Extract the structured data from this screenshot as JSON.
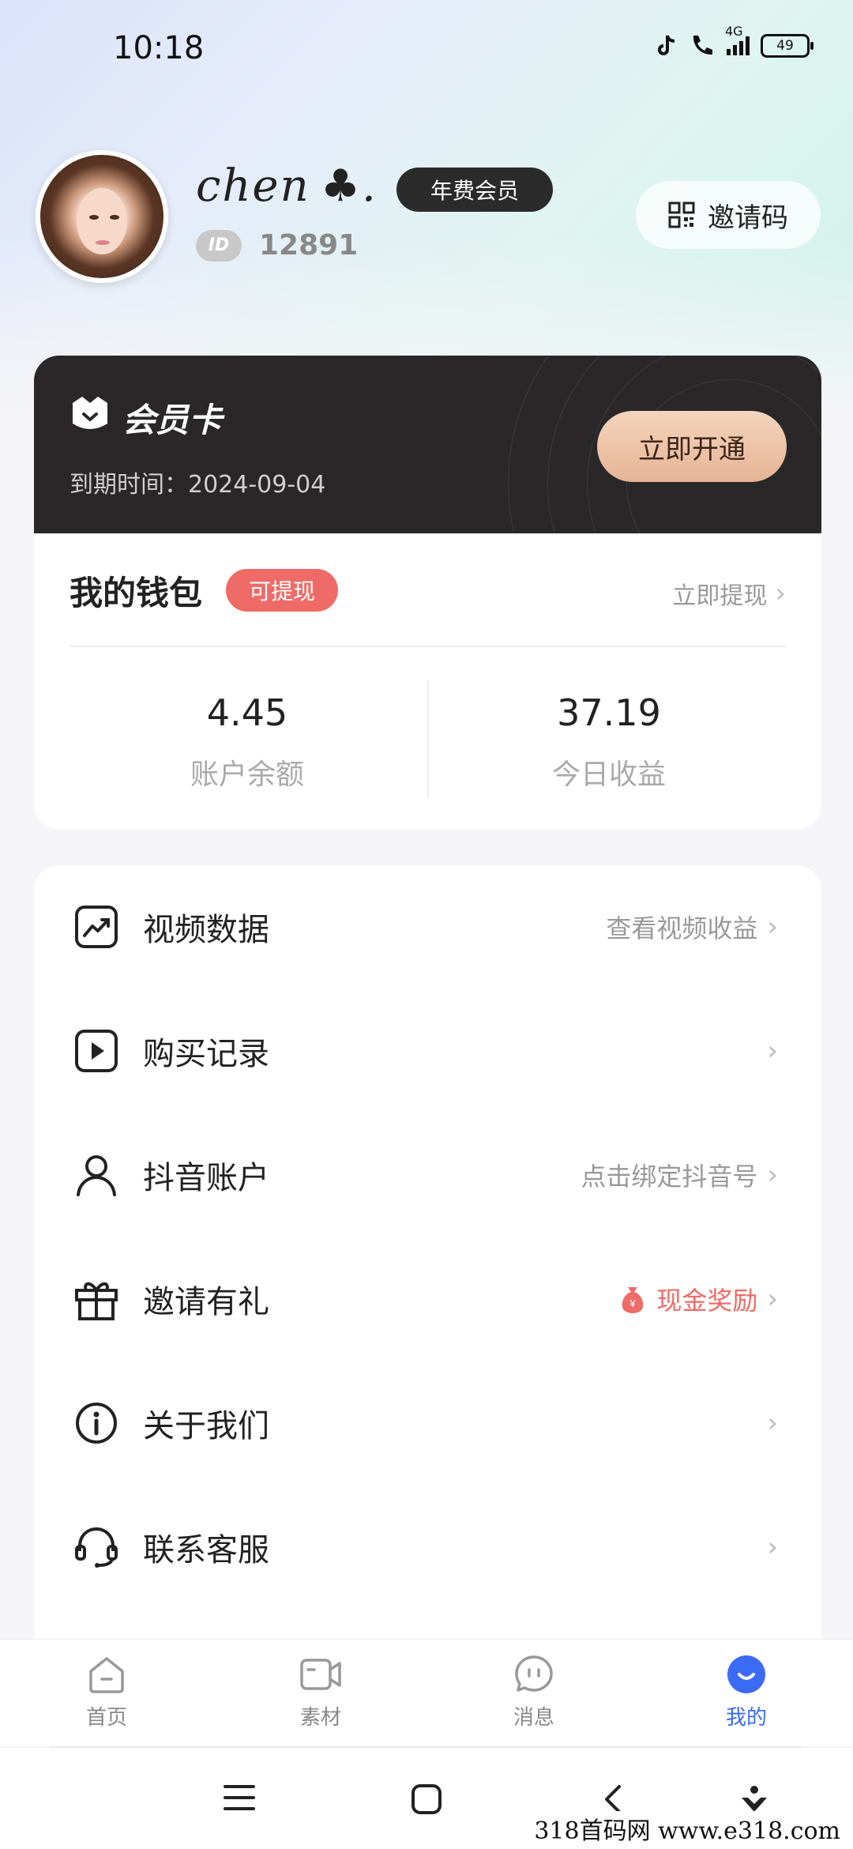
{
  "status_bar": {
    "time": "10:18",
    "network": "4G",
    "battery": "49"
  },
  "profile": {
    "username": "chen ♣.",
    "vip_badge": "年费会员",
    "id_tag": "ID",
    "id_number": "12891",
    "invite_label": "邀请码"
  },
  "member_card": {
    "title": "会员卡",
    "expire_text": "到期时间：2024-09-04",
    "open_button": "立即开通"
  },
  "wallet": {
    "title": "我的钱包",
    "tag": "可提现",
    "withdraw_link": "立即提现",
    "balance_value": "4.45",
    "balance_label": "账户余额",
    "today_value": "37.19",
    "today_label": "今日收益"
  },
  "menu": [
    {
      "label": "视频数据",
      "right": "查看视频收益",
      "icon": "trend-chart-icon"
    },
    {
      "label": "购买记录",
      "right": "",
      "icon": "play-icon"
    },
    {
      "label": "抖音账户",
      "right": "点击绑定抖音号",
      "icon": "user-icon"
    },
    {
      "label": "邀请有礼",
      "right": "现金奖励",
      "icon": "gift-icon"
    },
    {
      "label": "关于我们",
      "right": "",
      "icon": "info-icon"
    },
    {
      "label": "联系客服",
      "right": "",
      "icon": "headset-icon"
    }
  ],
  "tabs": [
    {
      "label": "首页",
      "icon": "home-icon"
    },
    {
      "label": "素材",
      "icon": "video-icon"
    },
    {
      "label": "消息",
      "icon": "message-icon"
    },
    {
      "label": "我的",
      "icon": "profile-icon"
    }
  ],
  "colors": {
    "accent": "#3b6af5",
    "highlight": "#ef6b67",
    "dark_card": "#2a2728",
    "gold": "#e6b495"
  },
  "watermark": "318首码网 www.e318.com"
}
